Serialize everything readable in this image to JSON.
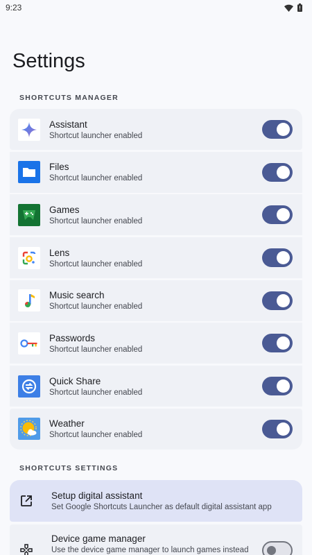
{
  "status_bar": {
    "time": "9:23"
  },
  "page": {
    "title": "Settings"
  },
  "shortcuts_manager": {
    "header": "SHORTCUTS MANAGER",
    "items": [
      {
        "title": "Assistant",
        "subtitle": "Shortcut launcher enabled",
        "icon": "assistant-icon",
        "enabled": true
      },
      {
        "title": "Files",
        "subtitle": "Shortcut launcher enabled",
        "icon": "files-icon",
        "enabled": true
      },
      {
        "title": "Games",
        "subtitle": "Shortcut launcher enabled",
        "icon": "games-icon",
        "enabled": true
      },
      {
        "title": "Lens",
        "subtitle": "Shortcut launcher enabled",
        "icon": "lens-icon",
        "enabled": true
      },
      {
        "title": "Music search",
        "subtitle": "Shortcut launcher enabled",
        "icon": "music-search-icon",
        "enabled": true
      },
      {
        "title": "Passwords",
        "subtitle": "Shortcut launcher enabled",
        "icon": "passwords-icon",
        "enabled": true
      },
      {
        "title": "Quick Share",
        "subtitle": "Shortcut launcher enabled",
        "icon": "quick-share-icon",
        "enabled": true
      },
      {
        "title": "Weather",
        "subtitle": "Shortcut launcher enabled",
        "icon": "weather-icon",
        "enabled": true
      }
    ]
  },
  "shortcuts_settings": {
    "header": "SHORTCUTS SETTINGS",
    "setup": {
      "title": "Setup digital assistant",
      "subtitle": "Set Google Shortcuts Launcher as default digital assistant app",
      "icon": "open-external-icon"
    },
    "game_manager": {
      "title": "Device game manager",
      "subtitle": "Use the device game manager to launch games instead",
      "icon": "gamepad-icon",
      "enabled": false
    }
  },
  "colors": {
    "background": "#f8f9fc",
    "card": "#eff1f6",
    "highlight_card": "#dfe3f6",
    "toggle_on": "#4a5a94",
    "toggle_off_track": "#e2e3ea"
  }
}
